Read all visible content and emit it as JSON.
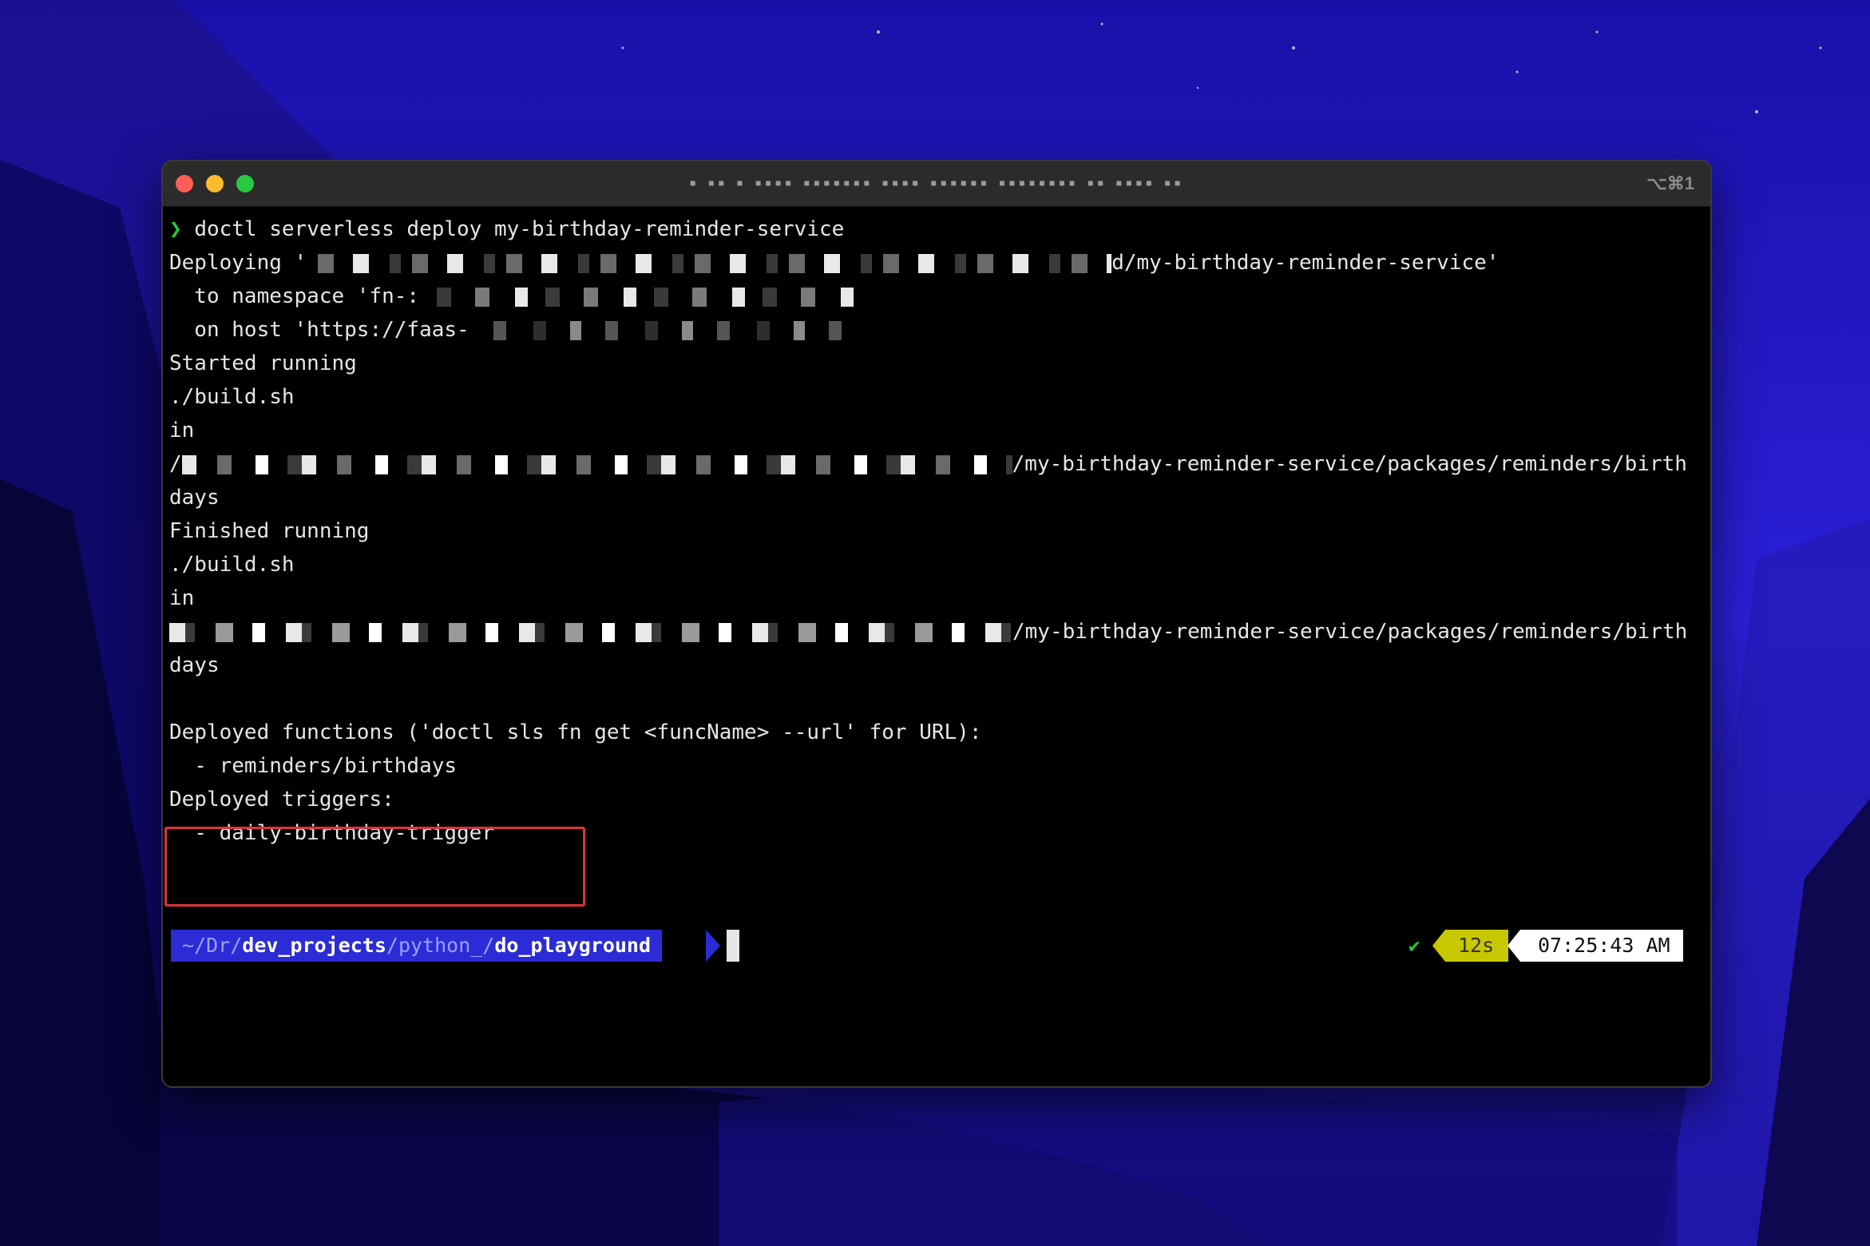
{
  "window": {
    "title": "▪ ▪▪  ▪ ▪▪▪▪ ▪▪▪▪▪▪▪ ▪▪▪▪ ▪▪▪▪▪▪  ▪▪▪▪▪▪▪▪  ▪▪ ▪▪▪▪ ▪▪",
    "shortcut": "⌥⌘1"
  },
  "terminal": {
    "lines": [
      {
        "prefix": "❯ ",
        "text": "doctl serverless deploy my-birthday-reminder-service"
      },
      {
        "text": "Deploying '",
        "tail": "d/my-birthday-reminder-service'"
      },
      {
        "text": "  to namespace 'fn-:"
      },
      {
        "text": "  on host 'https://faas-"
      },
      {
        "text": "Started running"
      },
      {
        "text": "./build.sh"
      },
      {
        "text": "in"
      },
      {
        "text": "/",
        "tail": "/my-birthday-reminder-service/packages/reminders/birth"
      },
      {
        "text": "days"
      },
      {
        "text": "Finished running"
      },
      {
        "text": "./build.sh"
      },
      {
        "text": "in"
      },
      {
        "text": "",
        "tail": "/my-birthday-reminder-service/packages/reminders/birth"
      },
      {
        "text": "days"
      },
      {
        "text": ""
      },
      {
        "text": "Deployed functions ('doctl sls fn get <funcName> --url' for URL):"
      },
      {
        "text": "  - reminders/birthdays"
      },
      {
        "text": "Deployed triggers:"
      },
      {
        "text": "  - daily-birthday-trigger"
      }
    ]
  },
  "prompt": {
    "path_prefix": "~/Dr/",
    "path_bold1": "dev_projects",
    "path_mid": "/python_/",
    "path_bold2": "do_playground",
    "status_check": "✔",
    "duration": "12s",
    "time": "07:25:43 AM"
  },
  "colors": {
    "prompt_bg": "#2c2cd6",
    "duration_bg": "#c8c800",
    "highlight": "#e03040"
  }
}
